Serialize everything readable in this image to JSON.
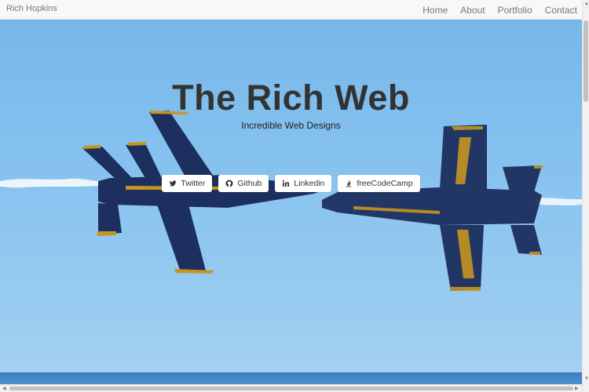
{
  "navbar": {
    "brand": "Rich Hopkins",
    "items": [
      {
        "label": "Home"
      },
      {
        "label": "About"
      },
      {
        "label": "Portfolio"
      },
      {
        "label": "Contact"
      }
    ]
  },
  "hero": {
    "title": "The Rich Web",
    "subtitle": "Incredible Web Designs",
    "buttons": [
      {
        "label": "Twitter",
        "icon": "twitter-icon"
      },
      {
        "label": "Github",
        "icon": "github-icon"
      },
      {
        "label": "Linkedin",
        "icon": "linkedin-icon"
      },
      {
        "label": "freeCodeCamp",
        "icon": "freecodecamp-icon"
      }
    ]
  },
  "colors": {
    "navbar_bg": "#f8f8f8",
    "sky": "#86c2ef",
    "jet_body": "#1c2f5e",
    "jet_accent": "#c7951f",
    "title_text": "#333333"
  }
}
